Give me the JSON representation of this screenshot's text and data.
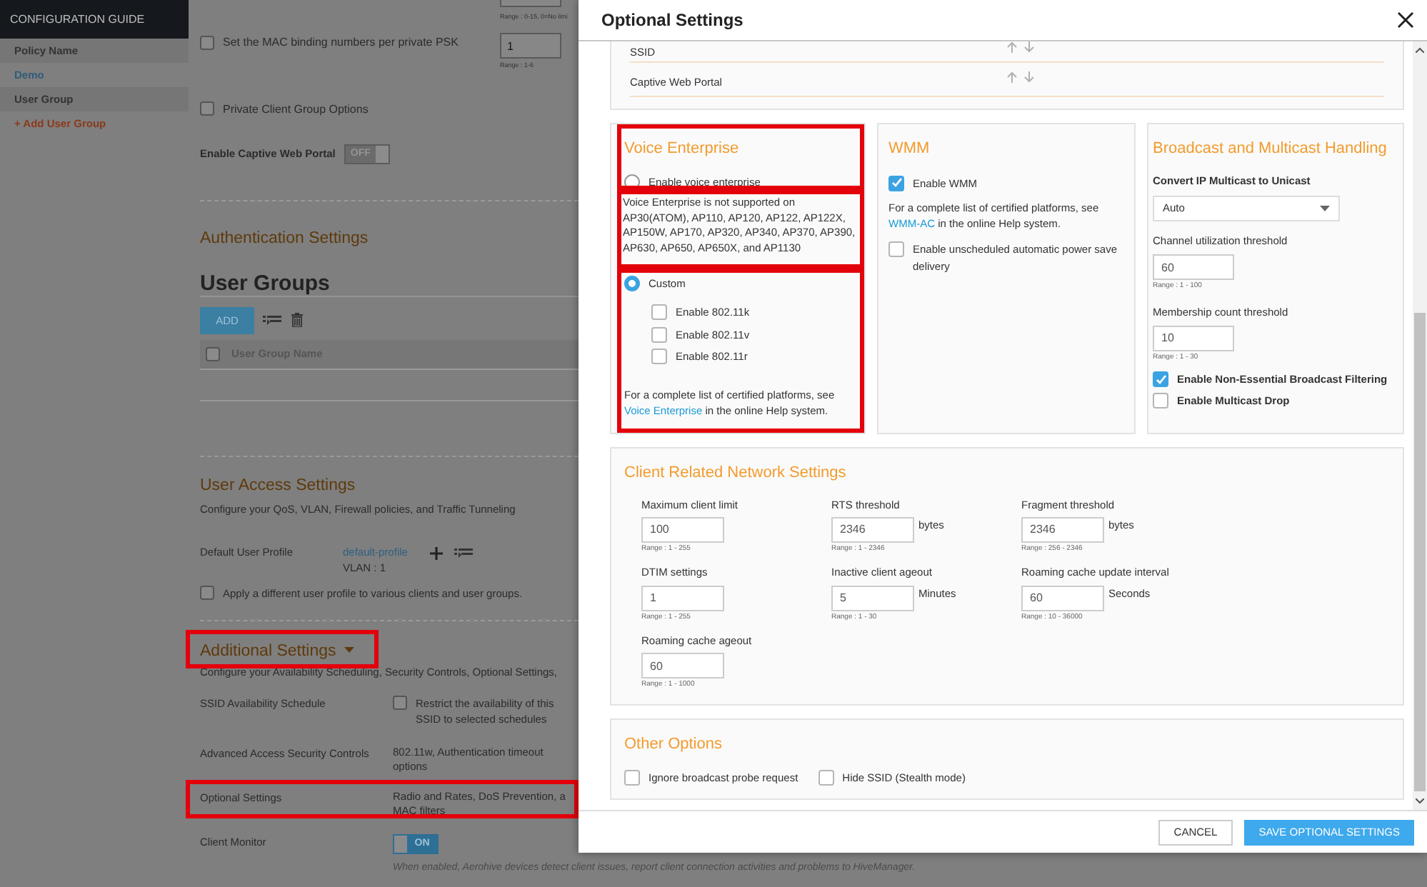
{
  "sidebar": {
    "header": "CONFIGURATION GUIDE",
    "items": [
      {
        "kind": "heading",
        "label": "Policy Name"
      },
      {
        "kind": "link",
        "label": "Demo"
      },
      {
        "kind": "heading",
        "label": "User Group"
      },
      {
        "kind": "action",
        "label": "+ Add User Group"
      }
    ]
  },
  "page": {
    "limit_field": {
      "range": "Range : 0-15, 0=No limi"
    },
    "mac_binding": {
      "label": "Set the MAC binding numbers per private PSK",
      "checked": false,
      "value": "1",
      "range": "Range : 1-6"
    },
    "private_client_group": {
      "label": "Private Client Group Options",
      "checked": false
    },
    "captive_portal": {
      "label": "Enable Captive Web Portal",
      "on": false,
      "switch_text": "OFF"
    },
    "authentication": {
      "title": "Authentication Settings"
    },
    "user_groups": {
      "title": "User Groups",
      "add_button": "ADD",
      "select_all_checked": false,
      "columns": [
        "User Group Name"
      ]
    },
    "user_access": {
      "title": "User Access Settings",
      "description": "Configure your QoS, VLAN, Firewall policies, and Traffic Tunneling",
      "profile_label": "Default User Profile",
      "profile_link": "default-profile",
      "vlan": "VLAN : 1",
      "apply_checked": false,
      "apply_label": "Apply a different user profile to various clients and user groups."
    },
    "additional": {
      "title": "Additional Settings",
      "highlighted": true,
      "description": "Configure your Availability Scheduling, Security Controls, Optional Settings,",
      "rows": [
        {
          "kind": "checkbox",
          "label": "SSID Availability Schedule",
          "checked": false,
          "text": "Restrict the availability of this SSID to selected schedules",
          "highlighted": false
        },
        {
          "kind": "text",
          "label": "Advanced Access Security Controls",
          "text": "802.11w, Authentication timeout options",
          "highlighted": false
        },
        {
          "kind": "text",
          "label": "Optional Settings",
          "text": "Radio and Rates, DoS Prevention, a\nMAC filters",
          "highlighted": true
        },
        {
          "kind": "switch",
          "label": "Client Monitor",
          "on": true,
          "switch_text": "ON",
          "note": "When enabled, Aerohive devices detect client issues, report client connection activities and problems to HiveManager.",
          "highlighted": false
        }
      ]
    }
  },
  "modal": {
    "title": "Optional Settings",
    "priority_rows": [
      {
        "label": "SSID"
      },
      {
        "label": "Captive Web Portal"
      }
    ],
    "voice": {
      "blocks": [
        {
          "kind": "intro",
          "highlighted": true,
          "title": "Voice Enterprise",
          "option": {
            "label": "Enable voice enterprise",
            "selected": false
          }
        },
        {
          "kind": "note",
          "highlighted": true,
          "text": "Voice Enterprise is not supported on AP30(ATOM), AP110, AP120, AP122, AP122X, AP150W, AP170, AP320, AP340, AP370, AP390, AP630, AP650, AP650X, and AP1130"
        },
        {
          "kind": "custom",
          "highlighted": true,
          "option": {
            "label": "Custom",
            "selected": true
          },
          "checkboxes": [
            {
              "label": "Enable 802.11k",
              "checked": false
            },
            {
              "label": "Enable 802.11v",
              "checked": false
            },
            {
              "label": "Enable 802.11r",
              "checked": false
            }
          ],
          "help": {
            "before": "For a complete list of certified platforms, see ",
            "link": "Voice Enterprise",
            "after": " in the online Help system."
          }
        }
      ]
    },
    "wmm": {
      "title": "WMM",
      "items": [
        {
          "kind": "checkbox",
          "label": "Enable WMM",
          "checked": true
        },
        {
          "kind": "help",
          "before": "For a complete list of certified platforms, see ",
          "link": "WMM-AC",
          "after": " in the online Help system."
        },
        {
          "kind": "checkbox",
          "label": "Enable unscheduled automatic power save delivery",
          "checked": false
        }
      ]
    },
    "broadcast": {
      "title": "Broadcast and Multicast Handling",
      "multicast_label": "Convert IP Multicast to Unicast",
      "multicast_value": "Auto",
      "fields": [
        {
          "label": "Channel utilization threshold",
          "value": "60",
          "range": "Range : 1 - 100"
        },
        {
          "label": "Membership count threshold",
          "value": "10",
          "range": "Range : 1 - 30"
        }
      ],
      "checkboxes": [
        {
          "label": "Enable Non-Essential Broadcast Filtering",
          "checked": true
        },
        {
          "label": "Enable Multicast Drop",
          "checked": false
        }
      ]
    },
    "client": {
      "title": "Client Related Network Settings",
      "fields": [
        {
          "label": "Maximum client limit",
          "value": "100",
          "range": "Range : 1 - 255"
        },
        {
          "label": "RTS threshold",
          "value": "2346",
          "unit": "bytes",
          "range": "Range : 1 - 2346"
        },
        {
          "label": "Fragment threshold",
          "value": "2346",
          "unit": "bytes",
          "range": "Range : 256 - 2346"
        },
        {
          "label": "DTIM settings",
          "value": "1",
          "range": "Range : 1 - 255"
        },
        {
          "label": "Inactive client ageout",
          "value": "5",
          "unit": "Minutes",
          "range": "Range : 1 - 30"
        },
        {
          "label": "Roaming cache update interval",
          "value": "60",
          "unit": "Seconds",
          "range": "Range : 10 - 36000"
        },
        {
          "label": "Roaming cache ageout",
          "value": "60",
          "range": "Range : 1 - 1000"
        }
      ]
    },
    "other": {
      "title": "Other Options",
      "checkboxes": [
        {
          "label": "Ignore broadcast probe request",
          "checked": false
        },
        {
          "label": "Hide SSID (Stealth mode)",
          "checked": false
        }
      ]
    },
    "buttons": [
      {
        "kind": "secondary",
        "label": "CANCEL"
      },
      {
        "kind": "primary",
        "label": "SAVE OPTIONAL SETTINGS"
      }
    ]
  }
}
